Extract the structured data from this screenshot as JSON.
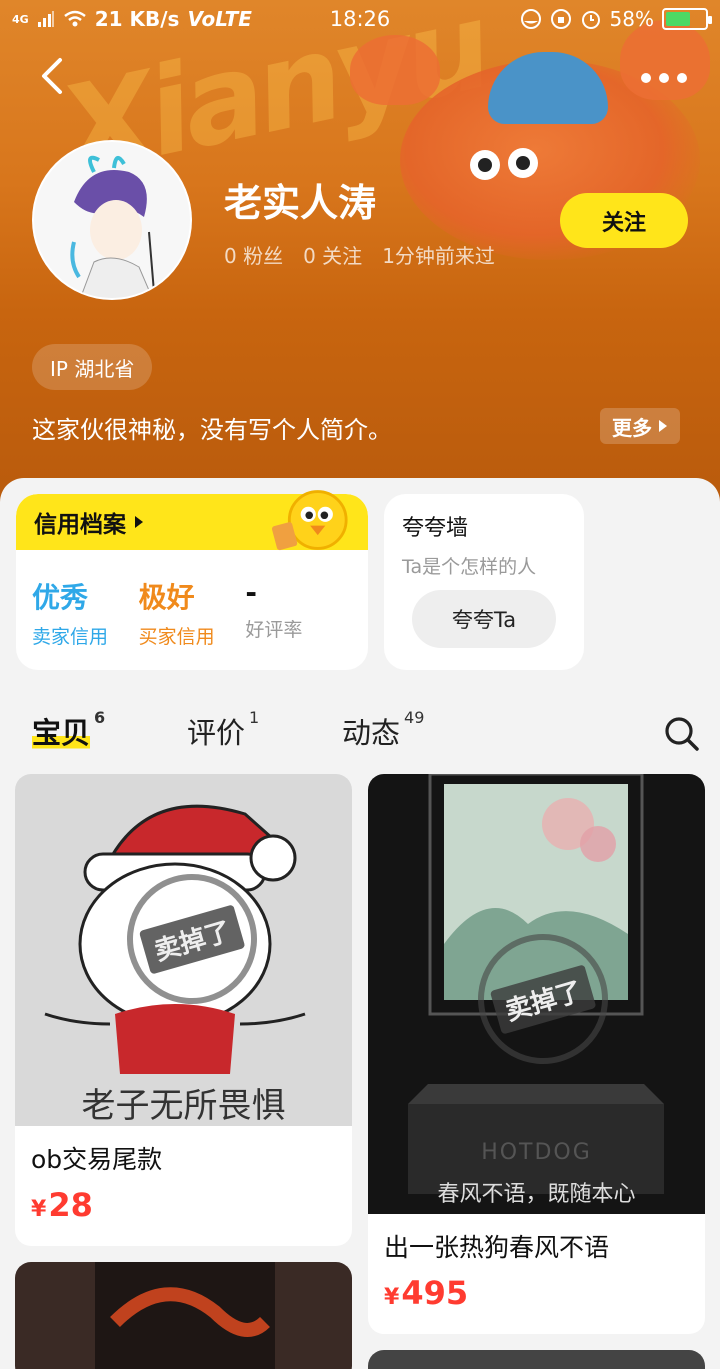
{
  "status_bar": {
    "network": "4G",
    "speed": "21 KB/s",
    "volte": "VoLTE",
    "time": "18:26",
    "battery": "58%",
    "battery_level": 0.58
  },
  "header": {
    "background_word": "Xianyu",
    "username": "老实人涛",
    "fans": "0 粉丝",
    "following": "0 关注",
    "last_seen": "1分钟前来过",
    "follow_label": "关注",
    "ip_label": "IP 湖北省",
    "bio": "这家伙很神秘，没有写个人简介。",
    "more_label": "更多"
  },
  "credit": {
    "title": "信用档案",
    "seller_value": "优秀",
    "seller_label": "卖家信用",
    "buyer_value": "极好",
    "buyer_label": "买家信用",
    "rating_value": "-",
    "rating_label": "好评率",
    "seller_color": "#2fa8e8",
    "buyer_color": "#f08a1c"
  },
  "praise": {
    "title": "夸夸墙",
    "subtitle": "Ta是个怎样的人",
    "button_label": "夸夸Ta"
  },
  "tabs": [
    {
      "label": "宝贝",
      "count": "6",
      "active": true
    },
    {
      "label": "评价",
      "count": "1",
      "active": false
    },
    {
      "label": "动态",
      "count": "49",
      "active": false
    }
  ],
  "products": [
    {
      "title": "ob交易尾款",
      "currency": "¥",
      "price": "28",
      "image_text": "老子无所畏惧",
      "stamp": "卖掉了"
    },
    {
      "title": "出一张热狗春风不语",
      "currency": "¥",
      "price": "495",
      "image_text": "春风不语，既随本心",
      "brand_text": "HOTDOG",
      "stamp": "卖掉了"
    }
  ],
  "colors": {
    "accent_yellow": "#ffe51a",
    "price_red": "#ff3b30",
    "header_orange": "#d8761c"
  }
}
